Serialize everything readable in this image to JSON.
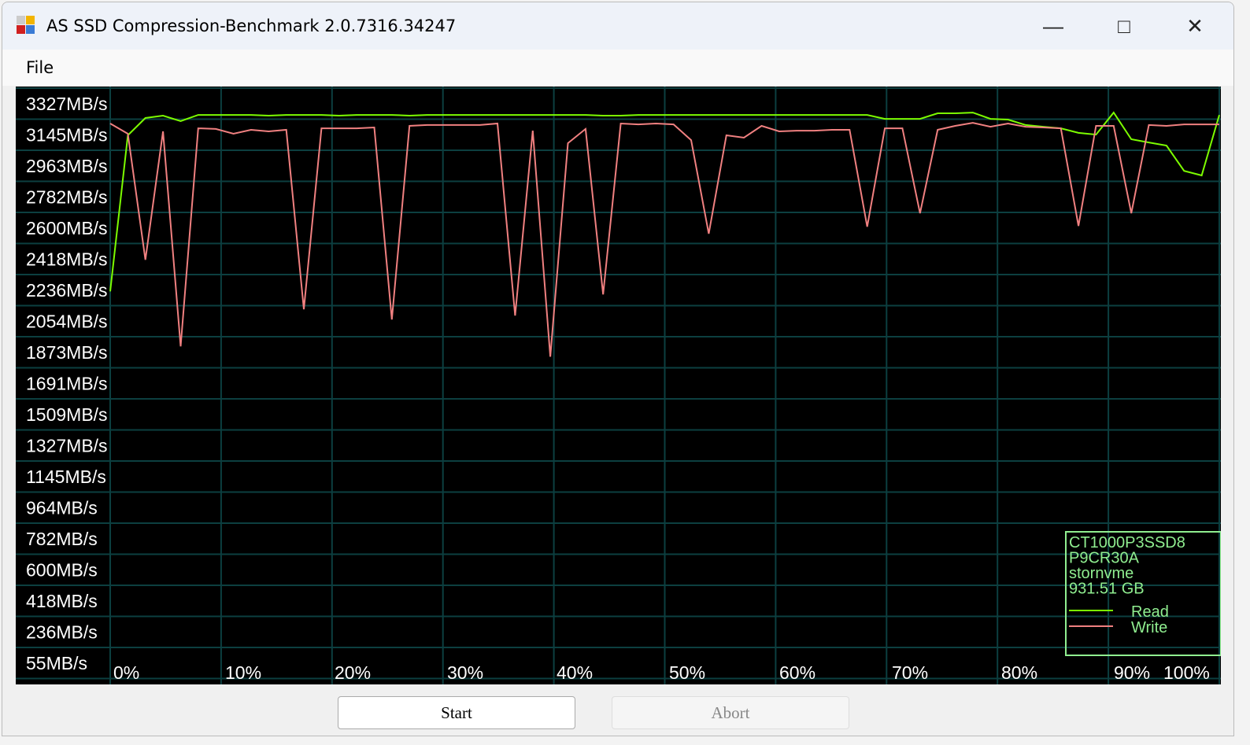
{
  "window": {
    "title": "AS SSD Compression-Benchmark 2.0.7316.34247",
    "minimize_icon": "minimize-icon",
    "maximize_icon": "maximize-icon",
    "close_icon": "close-icon"
  },
  "menu": {
    "file": "File"
  },
  "buttons": {
    "start": "Start",
    "abort": "Abort"
  },
  "legend": {
    "lines": [
      "CT1000P3SSD8",
      "P9CR30A",
      "stornvme",
      "931.51 GB"
    ],
    "read": "Read",
    "write": "Write"
  },
  "colors": {
    "read": "#7cfc00",
    "write": "#f08080",
    "grid": "#0c3f40",
    "legend_text": "#90ee90"
  },
  "chart_data": {
    "type": "line",
    "ytick_labels": [
      "3327MB/s",
      "3145MB/s",
      "2963MB/s",
      "2782MB/s",
      "2600MB/s",
      "2418MB/s",
      "2236MB/s",
      "2054MB/s",
      "1873MB/s",
      "1691MB/s",
      "1509MB/s",
      "1327MB/s",
      "1145MB/s",
      "964MB/s",
      "782MB/s",
      "600MB/s",
      "418MB/s",
      "236MB/s",
      "55MB/s"
    ],
    "xtick_labels": [
      "0%",
      "10%",
      "20%",
      "30%",
      "40%",
      "50%",
      "60%",
      "70%",
      "80%",
      "90%",
      "100%"
    ],
    "xlim": [
      0,
      100
    ],
    "ylim_mbps": [
      55,
      3327
    ],
    "grid": true,
    "legend_position": "bottom-right",
    "series": [
      {
        "name": "Read",
        "values": [
          2230,
          3143,
          3244,
          3258,
          3226,
          3262,
          3262,
          3262,
          3262,
          3258,
          3262,
          3262,
          3262,
          3258,
          3262,
          3262,
          3262,
          3258,
          3262,
          3262,
          3262,
          3262,
          3262,
          3262,
          3262,
          3262,
          3262,
          3262,
          3258,
          3258,
          3262,
          3262,
          3262,
          3262,
          3262,
          3262,
          3262,
          3262,
          3262,
          3262,
          3262,
          3262,
          3262,
          3262,
          3239,
          3239,
          3239,
          3272,
          3272,
          3276,
          3239,
          3235,
          3203,
          3193,
          3184,
          3157,
          3147,
          3276,
          3120,
          3101,
          3083,
          2935,
          2908,
          3262
        ]
      },
      {
        "name": "Write",
        "values": [
          3212,
          3152,
          2415,
          3166,
          1908,
          3184,
          3180,
          3152,
          3175,
          3166,
          3175,
          2125,
          3184,
          3184,
          3184,
          3189,
          2065,
          3198,
          3203,
          3203,
          3203,
          3203,
          3212,
          2088,
          3170,
          1848,
          3097,
          3180,
          2212,
          3212,
          3207,
          3212,
          3207,
          3115,
          2567,
          3143,
          3129,
          3198,
          3166,
          3170,
          3170,
          3175,
          3175,
          2608,
          3184,
          3184,
          2687,
          3175,
          3198,
          3216,
          3193,
          3212,
          3193,
          3189,
          3184,
          2613,
          3198,
          3198,
          2687,
          3203,
          3198,
          3207,
          3207,
          3207
        ]
      }
    ]
  }
}
